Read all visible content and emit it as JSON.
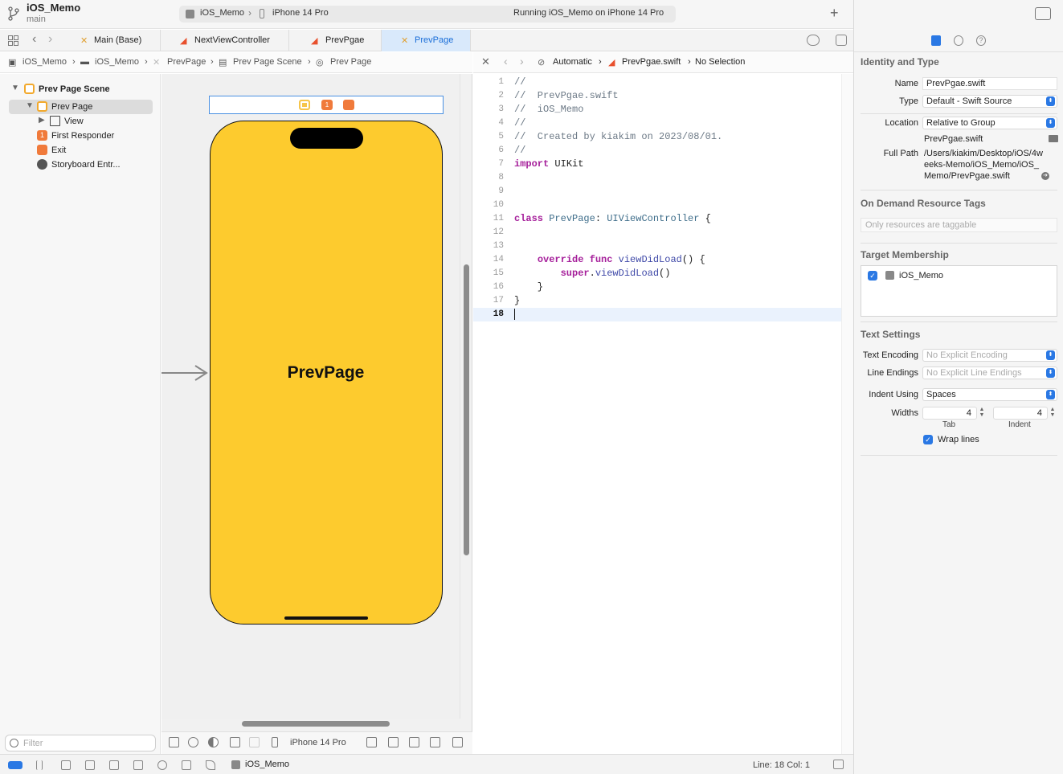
{
  "titlebar": {
    "project": "iOS_Memo",
    "branch": "main",
    "scheme_app": "iOS_Memo",
    "scheme_device": "iPhone 14 Pro",
    "status": "Running iOS_Memo on iPhone 14 Pro",
    "add_label": "+"
  },
  "tabs": [
    {
      "label": "Main (Base)",
      "icon": "storyboard-icon"
    },
    {
      "label": "NextViewController",
      "icon": "swift-icon"
    },
    {
      "label": "PrevPgae",
      "icon": "swift-icon"
    },
    {
      "label": "PrevPage",
      "icon": "storyboard-icon",
      "active": true
    }
  ],
  "breadcrumb_left": [
    "iOS_Memo",
    "iOS_Memo",
    "PrevPage",
    "Prev Page Scene",
    "Prev Page"
  ],
  "breadcrumb_right": {
    "mode": "Automatic",
    "file": "PrevPgae.swift",
    "selection": "No Selection"
  },
  "outline": {
    "scene": "Prev Page Scene",
    "controller": "Prev Page",
    "view": "View",
    "first_responder": "First Responder",
    "exit": "Exit",
    "entry": "Storyboard Entr...",
    "filter_placeholder": "Filter"
  },
  "canvas": {
    "phone_label": "PrevPage",
    "device": "iPhone 14 Pro",
    "phone_color": "#fdcb2e"
  },
  "code": {
    "lines": [
      "//",
      "//  PrevPgae.swift",
      "//  iOS_Memo",
      "//",
      "//  Created by kiakim on 2023/08/01.",
      "//",
      "import UIKit",
      "",
      "",
      "",
      "class PrevPage: UIViewController {",
      "",
      "",
      "    override func viewDidLoad() {",
      "        super.viewDidLoad()",
      "    }",
      "}",
      ""
    ],
    "line_numbers": [
      "1",
      "2",
      "3",
      "4",
      "5",
      "6",
      "7",
      "8",
      "9",
      "10",
      "11",
      "12",
      "13",
      "14",
      "15",
      "16",
      "17",
      "18"
    ],
    "current_line": 18
  },
  "inspector": {
    "identity_title": "Identity and Type",
    "name_label": "Name",
    "name_value": "PrevPgae.swift",
    "type_label": "Type",
    "type_value": "Default - Swift Source",
    "location_label": "Location",
    "location_value": "Relative to Group",
    "location_file": "PrevPgae.swift",
    "fullpath_label": "Full Path",
    "fullpath_value": "/Users/kiakim/Desktop/iOS/4weeks-Memo/iOS_Memo/iOS_Memo/PrevPgae.swift",
    "odr_title": "On Demand Resource Tags",
    "odr_placeholder": "Only resources are taggable",
    "target_title": "Target Membership",
    "target_item": "iOS_Memo",
    "text_title": "Text Settings",
    "encoding_label": "Text Encoding",
    "encoding_value": "No Explicit Encoding",
    "endings_label": "Line Endings",
    "endings_value": "No Explicit Line Endings",
    "indent_label": "Indent Using",
    "indent_value": "Spaces",
    "widths_label": "Widths",
    "tab_width": "4",
    "indent_width": "4",
    "tab_sub": "Tab",
    "indent_sub": "Indent",
    "wrap_label": "Wrap lines"
  },
  "statusbar": {
    "app": "iOS_Memo",
    "position": "Line: 18  Col: 1"
  },
  "colors": {
    "accent": "#2a78e4",
    "storyboard": "#f2a92d",
    "swift": "#e8502d"
  }
}
